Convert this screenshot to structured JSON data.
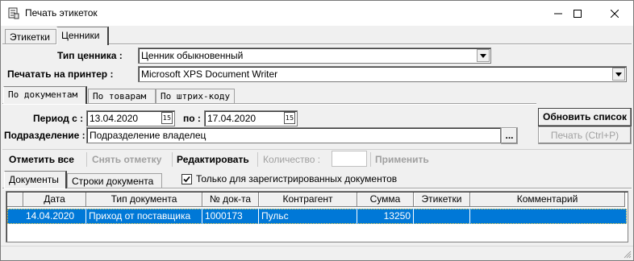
{
  "window": {
    "title": "Печать этикеток",
    "minimize_icon": "minimize-icon",
    "maximize_icon": "maximize-icon",
    "close_icon": "close-icon"
  },
  "top_tabs": [
    {
      "label": "Этикетки",
      "active": false
    },
    {
      "label": "Ценники",
      "active": true
    }
  ],
  "form": {
    "price_tag_type_label": "Тип ценника :",
    "price_tag_type_value": "Ценник обыкновенный",
    "printer_label": "Печатать на принтер :",
    "printer_value": "Microsoft XPS Document Writer"
  },
  "source_tabs": [
    {
      "label": "По документам",
      "active": true
    },
    {
      "label": "По товарам",
      "active": false
    },
    {
      "label": "По штрих-коду",
      "active": false
    }
  ],
  "filters": {
    "period_from_label": "Период с :",
    "period_from_value": "13.04.2020",
    "period_to_label": "по :",
    "period_to_value": "17.04.2020",
    "calendar_glyph": "15",
    "subdivision_label": "Подразделение :",
    "subdivision_value": "Подразделение владелец",
    "browse_label": "..."
  },
  "buttons": {
    "refresh": "Обновить список",
    "print": "Печать (Ctrl+P)"
  },
  "toolbar": {
    "mark_all": "Отметить все",
    "unmark": "Снять отметку",
    "edit": "Редактировать",
    "quantity_label": "Количество :",
    "quantity_value": "",
    "apply": "Применить"
  },
  "doc_tabs": [
    {
      "label": "Документы",
      "active": true
    },
    {
      "label": "Строки документа",
      "active": false
    }
  ],
  "registered_only": {
    "label": "Только для зарегистрированных документов",
    "checked": true
  },
  "grid": {
    "columns": [
      "Дата",
      "Тип документа",
      "№ док-та",
      "Контрагент",
      "Сумма",
      "Этикетки",
      "Комментарий"
    ],
    "rows": [
      {
        "date": "14.04.2020",
        "doc_type": "Приход от поставщика",
        "number": "1000173",
        "counterparty": "Пульс",
        "sum": "13250",
        "labels": "",
        "comment": "",
        "selected": true
      }
    ]
  },
  "colors": {
    "selection": "#0078d7",
    "focus_outline": "#ffd54a",
    "disabled_text": "#a0a0a0"
  }
}
